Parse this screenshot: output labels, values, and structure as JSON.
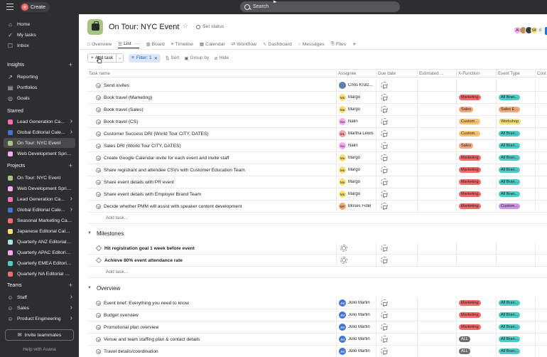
{
  "topbar": {
    "create_label": "Create",
    "search_placeholder": "Search"
  },
  "sidebar": {
    "nav": [
      {
        "label": "Home",
        "icon": "home-icon"
      },
      {
        "label": "My tasks",
        "icon": "check-circle-icon"
      },
      {
        "label": "Inbox",
        "icon": "bell-icon"
      }
    ],
    "insights_label": "Insights",
    "insights": [
      {
        "label": "Reporting",
        "icon": "trend-icon"
      },
      {
        "label": "Portfolios",
        "icon": "folder-icon"
      },
      {
        "label": "Goals",
        "icon": "person-target-icon"
      }
    ],
    "starred_label": "Starred",
    "starred": [
      {
        "label": "Lead Generation Ca...",
        "color": "#f26fb2",
        "chevron": true
      },
      {
        "label": "Global Editorial Cale...",
        "color": "#4573d2",
        "chevron": true
      },
      {
        "label": "On Tour: NYC Event",
        "color": "#a6c67e",
        "chevron": false,
        "active": true
      },
      {
        "label": "Web Development Sprint...",
        "color": "#f9aaef",
        "chevron": false
      }
    ],
    "projects_label": "Projects",
    "projects": [
      {
        "label": "On Tour: NYC Event",
        "color": "#a6c67e",
        "chevron": false
      },
      {
        "label": "Web Development Sprint...",
        "color": "#f9aaef",
        "chevron": false
      },
      {
        "label": "Lead Generation Ca...",
        "color": "#f26fb2",
        "chevron": true
      },
      {
        "label": "Global Editorial Cale...",
        "color": "#4573d2",
        "chevron": true
      },
      {
        "label": "Seasonal Marketing Cam...",
        "color": "#f06a6a",
        "chevron": false
      },
      {
        "label": "Japanese Editorial Calen...",
        "color": "#f8df72",
        "chevron": false
      },
      {
        "label": "Quarterly ANZ Editorial C...",
        "color": "#9ee7e3",
        "chevron": false
      },
      {
        "label": "Quarterly APAC Editorial ...",
        "color": "#f9aaef",
        "chevron": false
      },
      {
        "label": "Quarterly EMEA Editorial...",
        "color": "#4ecbc4",
        "chevron": false
      },
      {
        "label": "Quarterly NA Editorial Ca...",
        "color": "#f06a6a",
        "chevron": false
      }
    ],
    "teams_label": "Teams",
    "teams": [
      {
        "label": "Staff"
      },
      {
        "label": "Sales"
      },
      {
        "label": "Product Engineering"
      }
    ],
    "invite_label": "Invite teammates",
    "help_label": "Help with Asana"
  },
  "header": {
    "project_title": "On Tour: NYC Event",
    "set_status": "Set status",
    "member_count": "8",
    "members": [
      {
        "initials": "Al",
        "color": "#f9aaef"
      },
      {
        "initials": "",
        "color": "#c58b5b"
      },
      {
        "initials": "",
        "color": "#3a3a3c"
      },
      {
        "initials": "SW",
        "color": "#f8df72"
      }
    ],
    "tabs": [
      {
        "label": "Overview",
        "icon": "overview-icon"
      },
      {
        "label": "List",
        "icon": "list-icon",
        "active": true
      },
      {
        "label": "Board",
        "icon": "board-icon"
      },
      {
        "label": "Timeline",
        "icon": "timeline-icon"
      },
      {
        "label": "Calendar",
        "icon": "calendar-icon"
      },
      {
        "label": "Workflow",
        "icon": "workflow-icon"
      },
      {
        "label": "Dashboard",
        "icon": "dashboard-icon"
      },
      {
        "label": "Messages",
        "icon": "message-icon"
      },
      {
        "label": "Files",
        "icon": "file-icon"
      }
    ]
  },
  "toolbar": {
    "add_task": "Add task",
    "filter": "Filter: 1",
    "sort": "Sort",
    "group_by": "Group by",
    "hide": "Hide"
  },
  "table": {
    "columns": [
      "Task name",
      "Assignee",
      "Due date",
      "Estimated ...",
      "X-Function",
      "Event Type",
      "Cost"
    ],
    "add_task_label": "Add task...",
    "tasks": [
      {
        "name": "Send invites",
        "assignee": "Chris Krutz...",
        "initials": "",
        "av_color": "#5a7fa8",
        "xf": "",
        "xf_color": "",
        "ev": "",
        "ev_color": ""
      },
      {
        "name": "Book travel (Marketing)",
        "assignee": "Margo",
        "initials": "Ma",
        "av_color": "#f8df72",
        "xf": "Marketing",
        "xf_color": "#f06a6a",
        "ev": "All Bran...",
        "ev_color": "#4ecbc4"
      },
      {
        "name": "Book travel (Sales)",
        "assignee": "Margo",
        "initials": "Ma",
        "av_color": "#f8df72",
        "xf": "Sales",
        "xf_color": "#f1a97b",
        "ev": "Sales E...",
        "ev_color": "#f1a97b"
      },
      {
        "name": "Book travel (CS)",
        "assignee": "Nalin",
        "initials": "Na",
        "av_color": "#f9aaef",
        "xf": "Custom...",
        "xf_color": "#f8c471",
        "ev": "Workshop",
        "ev_color": "#f8df72"
      },
      {
        "name": "Customer Success DRI (World Tour CITY, DATES)",
        "assignee": "Martha Lewis",
        "initials": "ML",
        "av_color": "#f4a4a4",
        "xf": "Custom...",
        "xf_color": "#f8c471",
        "ev": "All Bran...",
        "ev_color": "#4ecbc4"
      },
      {
        "name": "Sales DRI (World Tour CITY, DATES)",
        "assignee": "Nalin",
        "initials": "Na",
        "av_color": "#f9aaef",
        "xf": "Sales",
        "xf_color": "#f1a97b",
        "ev": "All Bran...",
        "ev_color": "#4ecbc4"
      },
      {
        "name": "Create Google Calendar invite for each event and invite staff",
        "assignee": "Margo",
        "initials": "Ma",
        "av_color": "#f8df72",
        "xf": "Marketing",
        "xf_color": "#f06a6a",
        "ev": "All Bran...",
        "ev_color": "#4ecbc4"
      },
      {
        "name": "Share registrant and attendee CSVs with Customer Education Team",
        "assignee": "Margo",
        "initials": "Ma",
        "av_color": "#f8df72",
        "xf": "Marketing",
        "xf_color": "#f06a6a",
        "ev": "All Bran...",
        "ev_color": "#4ecbc4"
      },
      {
        "name": "Share event details with PR event",
        "assignee": "Margo",
        "initials": "Ma",
        "av_color": "#f8df72",
        "xf": "Marketing",
        "xf_color": "#f06a6a",
        "ev": "All Bran...",
        "ev_color": "#4ecbc4"
      },
      {
        "name": "Share event details with Employer Brand Team",
        "assignee": "Margo",
        "initials": "Ma",
        "av_color": "#f8df72",
        "xf": "Marketing",
        "xf_color": "#f06a6a",
        "ev": "All Bran...",
        "ev_color": "#4ecbc4"
      },
      {
        "name": "Decide whether PMM will assist with speaker content development",
        "assignee": "Moses Fidel",
        "initials": "MF",
        "av_color": "#f1a97b",
        "xf": "Marketing",
        "xf_color": "#f06a6a",
        "ev": "Custom...",
        "ev_color": "#cd95ea"
      }
    ],
    "milestones_title": "Milestones",
    "milestones": [
      {
        "name": "Hit registration goal 1 week before event"
      },
      {
        "name": "Achieve 80% event attendance rate"
      }
    ],
    "overview_title": "Overview",
    "overview": [
      {
        "name": "Event brief: Everything you need to know",
        "assignee": "Julio Martin",
        "initials": "JM",
        "av_color": "#4573d2",
        "xf": "Marketing",
        "xf_color": "#f06a6a",
        "ev": "All Bran...",
        "ev_color": "#4ecbc4"
      },
      {
        "name": "Budget overview",
        "assignee": "Julio Martin",
        "initials": "JM",
        "av_color": "#4573d2",
        "xf": "Marketing",
        "xf_color": "#f06a6a",
        "ev": "All Bran...",
        "ev_color": "#4ecbc4"
      },
      {
        "name": "Promotional plan overview",
        "assignee": "Julio Martin",
        "initials": "JM",
        "av_color": "#4573d2",
        "xf": "Marketing",
        "xf_color": "#f06a6a",
        "ev": "All Bran...",
        "ev_color": "#4ecbc4"
      },
      {
        "name": "Venue and team staffing plan & contact details",
        "assignee": "Julio Martin",
        "initials": "JM",
        "av_color": "#4573d2",
        "xf": "ALL",
        "xf_color": "#6d6e6f",
        "ev": "All Bran...",
        "ev_color": "#4ecbc4"
      },
      {
        "name": "Travel details/coordination",
        "assignee": "Julio Martin",
        "initials": "JM",
        "av_color": "#4573d2",
        "xf": "ALL",
        "xf_color": "#6d6e6f",
        "ev": "All Bran...",
        "ev_color": "#4ecbc4"
      }
    ]
  }
}
